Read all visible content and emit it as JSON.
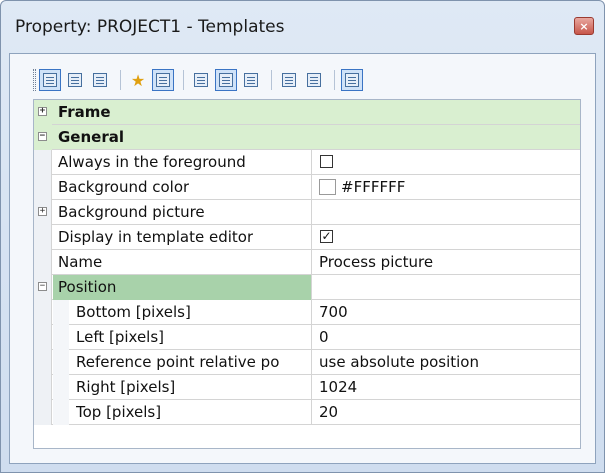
{
  "window": {
    "title": "Property: PROJECT1 - Templates",
    "close_label": "×"
  },
  "toolbar": {
    "buttons": [
      "categorized-view",
      "page-view",
      "list-view",
      "favorites",
      "properties-view",
      "object-view",
      "collapse-view",
      "expand-view",
      "grid-view",
      "list-detail-view",
      "summary-view"
    ]
  },
  "grid": {
    "rows": [
      {
        "label": "Frame",
        "value": ""
      },
      {
        "label": "General",
        "value": ""
      },
      {
        "label": "Always in the foreground",
        "value": ""
      },
      {
        "label": "Background color",
        "value": "#FFFFFF"
      },
      {
        "label": "Background picture",
        "value": ""
      },
      {
        "label": "Display in template editor",
        "value": ""
      },
      {
        "label": "Name",
        "value": "Process picture"
      },
      {
        "label": "Position",
        "value": ""
      },
      {
        "label": "Bottom [pixels]",
        "value": "700"
      },
      {
        "label": "Left [pixels]",
        "value": "0"
      },
      {
        "label": "Reference point relative po",
        "value": "use absolute position"
      },
      {
        "label": "Right [pixels]",
        "value": "1024"
      },
      {
        "label": "Top [pixels]",
        "value": "20"
      }
    ],
    "expanders": {
      "collapsed": "+",
      "expanded": "−"
    },
    "checkbox_checked": "✓",
    "colors": {
      "category_bg": "#d9efd0",
      "selected_bg": "#a8d2aa",
      "background_color_value": "#FFFFFF"
    }
  }
}
